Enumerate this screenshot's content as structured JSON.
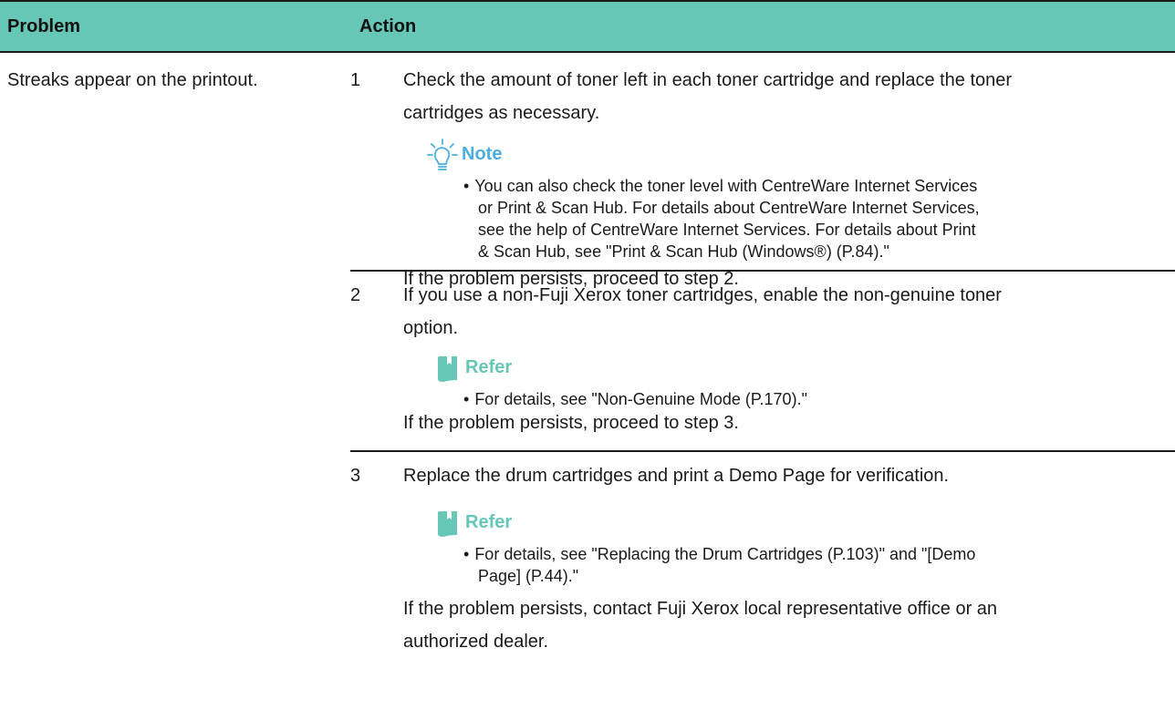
{
  "header": {
    "problem": "Problem",
    "action": "Action"
  },
  "problem_text": "Streaks appear on the printout.",
  "steps": [
    {
      "number": "1",
      "line1": "Check the amount of toner left in each toner cartridge and replace the toner",
      "line2": "cartridges as necessary.",
      "callout_title": "Note",
      "callout_icon": "lightbulb-icon",
      "bullet_lines": [
        "You can also check the toner level with CentreWare Internet Services",
        "or Print & Scan Hub. For details about CentreWare Internet Services,",
        "see the help of CentreWare Internet Services. For details about Print",
        "& Scan Hub, see \"Print & Scan Hub (Windows®) (P.84).\""
      ],
      "persist": "If the problem persists, proceed to step 2."
    },
    {
      "number": "2",
      "line1": "If you use a non-Fuji Xerox toner cartridges, enable the non-genuine toner",
      "line2": "option.",
      "callout_title": "Refer",
      "callout_icon": "book-icon",
      "bullet_lines": [
        "For details, see \"Non-Genuine Mode (P.170).\""
      ],
      "persist": "If the problem persists, proceed to step 3."
    },
    {
      "number": "3",
      "line1": "Replace the drum cartridges and print a Demo Page for verification.",
      "callout_title": "Refer",
      "callout_icon": "book-icon",
      "bullet_lines": [
        "For details, see \"Replacing the Drum Cartridges (P.103)\" and \"[Demo",
        "Page] (P.44).\""
      ],
      "persist_lines": [
        "If the problem persists, contact Fuji Xerox local representative office or an",
        "authorized dealer."
      ]
    }
  ],
  "colors": {
    "header_bg": "#67c7b6",
    "note_blue": "#4aaee0",
    "refer_teal": "#67c7b6"
  }
}
